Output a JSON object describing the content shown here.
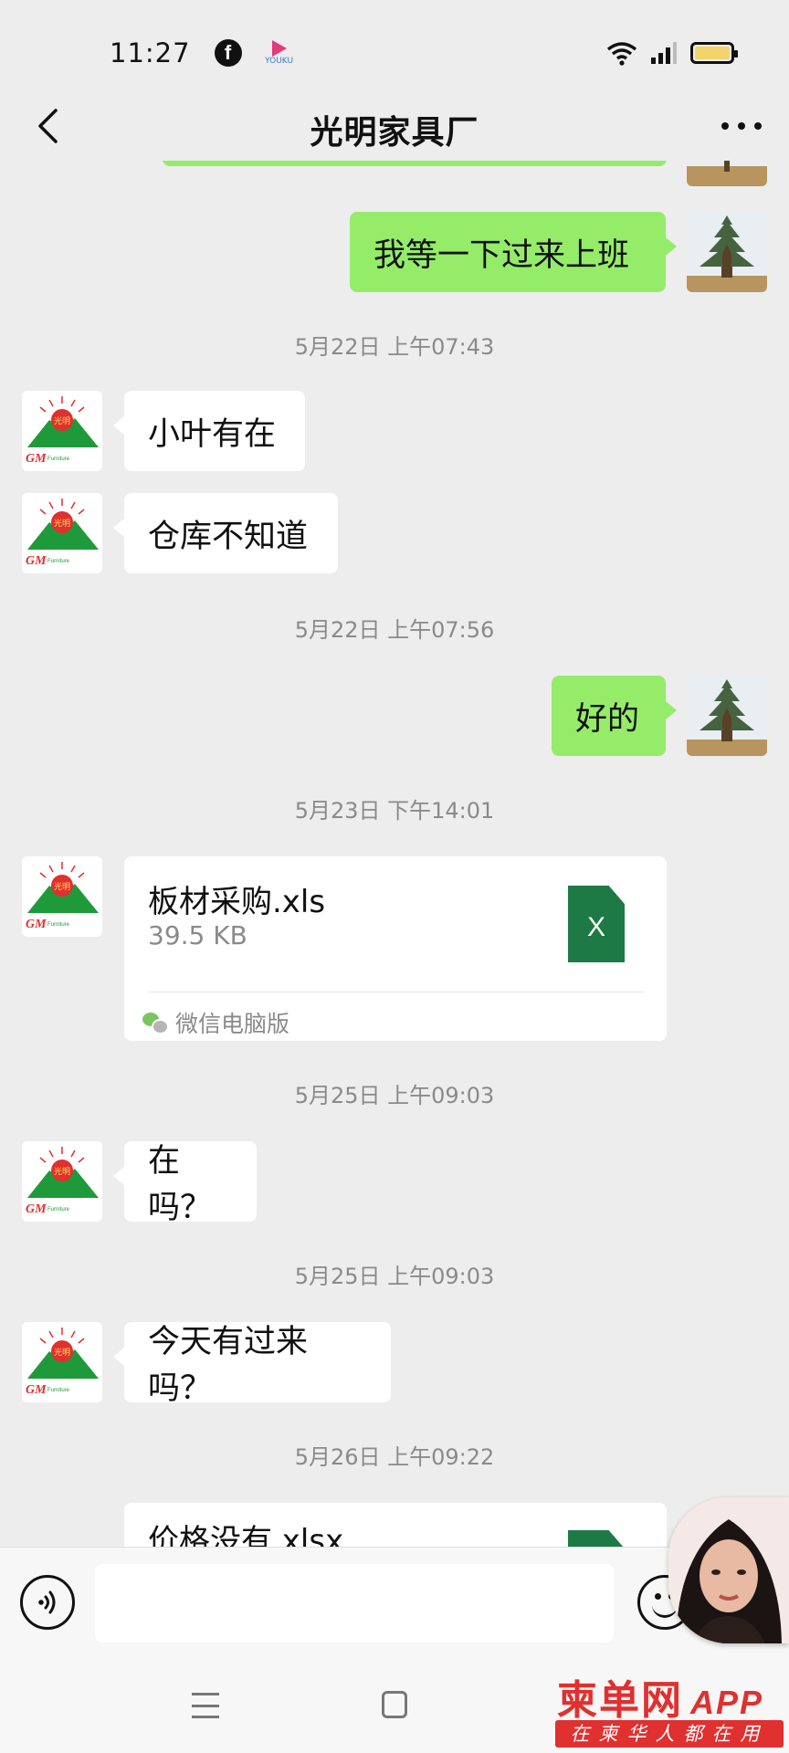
{
  "status_bar": {
    "time": "11:27",
    "facebook_glyph": "f",
    "youku_label": "YOUKU"
  },
  "header": {
    "title": "光明家具厂"
  },
  "messages": [
    {
      "type": "text",
      "from": "self",
      "text": "我等一下过来上班"
    },
    {
      "type": "timestamp",
      "text": "5月22日 上午07:43"
    },
    {
      "type": "text",
      "from": "other",
      "text": "小叶有在"
    },
    {
      "type": "text",
      "from": "other",
      "text": "仓库不知道"
    },
    {
      "type": "timestamp",
      "text": "5月22日 上午07:56"
    },
    {
      "type": "text",
      "from": "self",
      "text": "好的"
    },
    {
      "type": "timestamp",
      "text": "5月23日 下午14:01"
    },
    {
      "type": "file",
      "from": "other",
      "name": "板材采购.xls",
      "size": "39.5 KB",
      "source": "微信电脑版",
      "icon": "excel-file-icon",
      "icon_letter": "X"
    },
    {
      "type": "timestamp",
      "text": "5月25日 上午09:03"
    },
    {
      "type": "text",
      "from": "other",
      "text": "在吗？"
    },
    {
      "type": "timestamp",
      "text": "5月25日 上午09:03"
    },
    {
      "type": "text",
      "from": "other",
      "text": "今天有过来吗？"
    },
    {
      "type": "timestamp",
      "text": "5月26日 上午09:22"
    },
    {
      "type": "file",
      "from": "other",
      "name": "价格没有.xlsx",
      "icon": "excel-file-icon"
    }
  ],
  "avatars": {
    "other_logo_text": "光明",
    "other_logo_initials": "GM",
    "other_logo_word": "Furniture"
  },
  "colors": {
    "self_bubble": "#95ec69",
    "other_bubble": "#ffffff",
    "background": "#ededed",
    "excel_green": "#1e7a45",
    "logo_red": "#e0302f",
    "logo_green": "#1f9a3b"
  },
  "watermark": {
    "brand": "柬单网",
    "app": "APP",
    "slogan": "在柬华人都在用"
  }
}
